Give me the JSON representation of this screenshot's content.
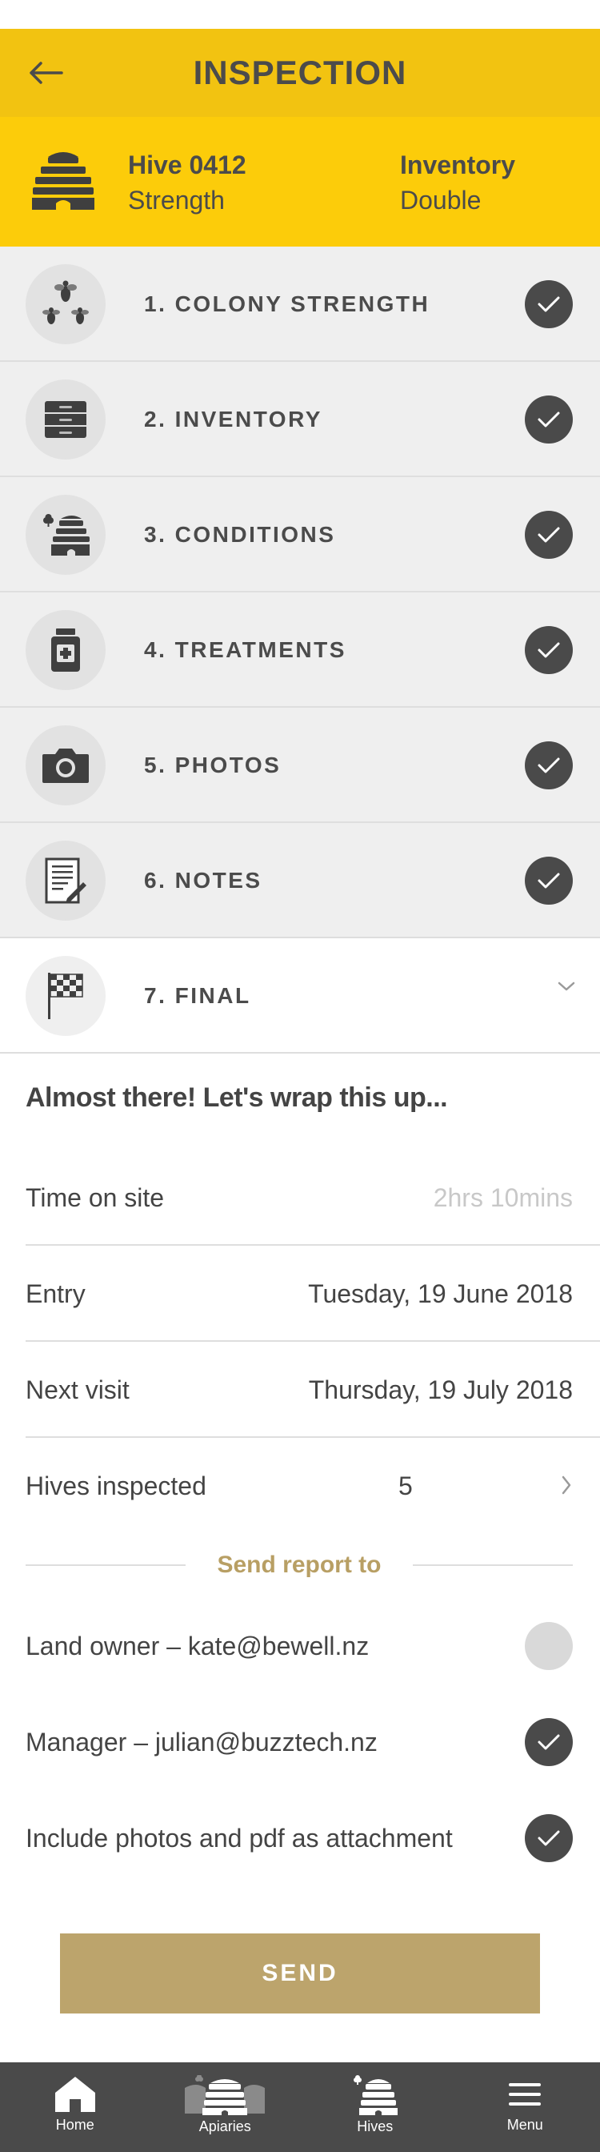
{
  "header": {
    "title": "INSPECTION",
    "back_icon": "arrow-left-icon"
  },
  "hive": {
    "name": "Hive 0412",
    "subtitle": "Strength",
    "inventory_title": "Inventory",
    "inventory_value": "Double"
  },
  "steps": [
    {
      "label": "1. COLONY STRENGTH",
      "icon": "bees-icon",
      "complete": true
    },
    {
      "label": "2. INVENTORY",
      "icon": "hive-box-icon",
      "complete": true
    },
    {
      "label": "3. CONDITIONS",
      "icon": "beehive-icon",
      "complete": true
    },
    {
      "label": "4. TREATMENTS",
      "icon": "medicine-jar-icon",
      "complete": true
    },
    {
      "label": "5. PHOTOS",
      "icon": "camera-icon",
      "complete": true
    },
    {
      "label": "6. NOTES",
      "icon": "notepad-icon",
      "complete": true
    },
    {
      "label": "7. FINAL",
      "icon": "checkered-flag-icon",
      "expanded": true
    }
  ],
  "final": {
    "heading": "Almost there! Let's wrap this up...",
    "time_on_site_label": "Time on site",
    "time_on_site_value": "2hrs 10mins",
    "entry_label": "Entry",
    "entry_value": "Tuesday, 19 June 2018",
    "next_visit_label": "Next visit",
    "next_visit_value": "Thursday, 19 July 2018",
    "hives_inspected_label": "Hives inspected",
    "hives_inspected_value": "5",
    "send_report_to": "Send report to",
    "land_owner": "Land owner – kate@bewell.nz",
    "land_owner_checked": false,
    "manager": "Manager – julian@buzztech.nz",
    "manager_checked": true,
    "attachments": "Include photos and pdf as attachment",
    "attachments_checked": true,
    "send_label": "SEND"
  },
  "tabbar": {
    "home": "Home",
    "apiaries": "Apiaries",
    "hives": "Hives",
    "menu": "Menu"
  },
  "colors": {
    "title_bar": "#f2c311",
    "hive_bar": "#fccc0a",
    "accent_gold": "#bca46c",
    "dark": "#4a4a4a"
  }
}
